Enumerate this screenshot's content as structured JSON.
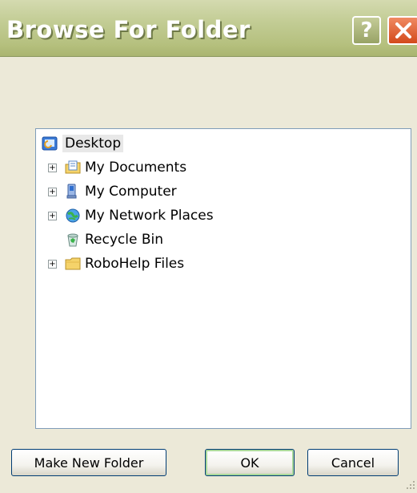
{
  "window": {
    "title": "Browse For Folder",
    "help_label": "?",
    "close_icon": "close-icon"
  },
  "tree": {
    "items": [
      {
        "label": "Desktop",
        "icon": "desktop-icon",
        "expandable": false,
        "selected": true
      },
      {
        "label": "My Documents",
        "icon": "my-documents-icon",
        "expandable": true
      },
      {
        "label": "My Computer",
        "icon": "my-computer-icon",
        "expandable": true
      },
      {
        "label": "My Network Places",
        "icon": "network-places-icon",
        "expandable": true
      },
      {
        "label": "Recycle Bin",
        "icon": "recycle-bin-icon",
        "expandable": false
      },
      {
        "label": "RoboHelp Files",
        "icon": "folder-icon",
        "expandable": true
      }
    ]
  },
  "buttons": {
    "make_new_folder": "Make New Folder",
    "ok": "OK",
    "cancel": "Cancel"
  },
  "colors": {
    "titlebar": "#b5c07e",
    "dialog_bg": "#ece9d8",
    "close_button": "#d34a1c"
  }
}
